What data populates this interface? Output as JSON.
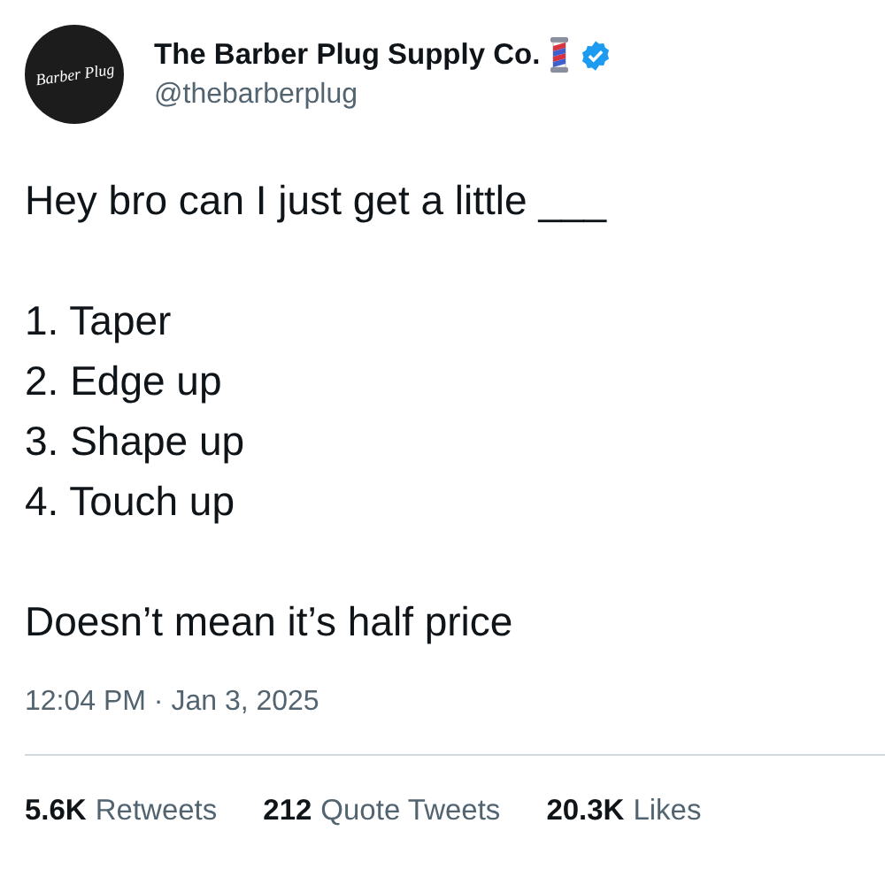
{
  "author": {
    "name": "The Barber Plug Supply Co.",
    "handle": "@thebarberplug",
    "verified": true,
    "avatar_text": "Barber Plug"
  },
  "body": [
    {
      "lines": [
        "Hey bro can I just get a little ___"
      ]
    },
    {
      "lines": [
        "1. Taper",
        "2. Edge up",
        "3. Shape up",
        "4. Touch up"
      ]
    },
    {
      "lines": [
        "Doesn’t mean it’s half price"
      ]
    }
  ],
  "timestamp": "12:04 PM · Jan 3, 2025",
  "stats": [
    {
      "count": "5.6K",
      "label": "Retweets"
    },
    {
      "count": "212",
      "label": "Quote Tweets"
    },
    {
      "count": "20.3K",
      "label": "Likes"
    }
  ]
}
